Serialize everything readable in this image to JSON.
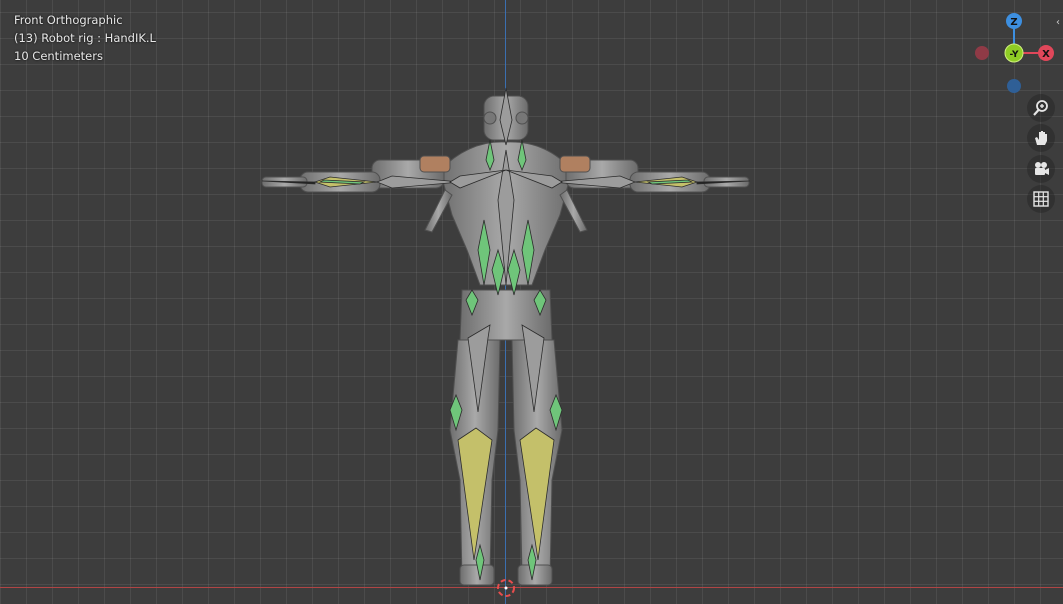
{
  "viewport": {
    "view_name": "Front Orthographic",
    "object_info": "(13) Robot rig : HandIK.L",
    "scale_info": "10 Centimeters"
  },
  "gizmo": {
    "z_label": "Z",
    "y_label": "-Y",
    "x_label": "X",
    "colors": {
      "x": "#e0475a",
      "y": "#8fcd25",
      "z": "#3d8fe0",
      "neg_x": "#8f3a46",
      "neg_z": "#2f5f96"
    }
  },
  "nav_buttons": [
    {
      "icon": "zoom-icon"
    },
    {
      "icon": "hand-pan-icon"
    },
    {
      "icon": "camera-icon"
    },
    {
      "icon": "grid-icon"
    }
  ],
  "colors": {
    "background": "#3d3d3d",
    "bone_gray": "#9c9c9c",
    "bone_selected": "#c4c06a",
    "bone_green": "#6fc57a"
  }
}
